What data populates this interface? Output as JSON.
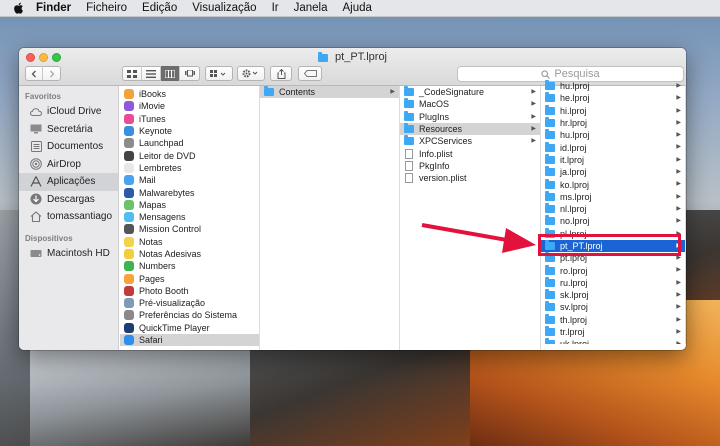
{
  "menubar": {
    "items": [
      "Finder",
      "Ficheiro",
      "Edição",
      "Visualização",
      "Ir",
      "Janela",
      "Ajuda"
    ]
  },
  "window": {
    "title": "pt_PT.lproj",
    "search_placeholder": "Pesquisa"
  },
  "sidebar": {
    "favorites_heading": "Favoritos",
    "favorites": [
      {
        "label": "iCloud Drive",
        "icon": "cloud-icon"
      },
      {
        "label": "Secretária",
        "icon": "desktop-icon"
      },
      {
        "label": "Documentos",
        "icon": "documents-icon"
      },
      {
        "label": "AirDrop",
        "icon": "airdrop-icon"
      },
      {
        "label": "Aplicações",
        "icon": "applications-icon",
        "selected": true
      },
      {
        "label": "Descargas",
        "icon": "downloads-icon"
      },
      {
        "label": "tomassantiago",
        "icon": "home-icon"
      }
    ],
    "devices_heading": "Dispositivos",
    "devices": [
      {
        "label": "Macintosh HD",
        "icon": "disk-icon"
      }
    ]
  },
  "column_apps": [
    {
      "label": "iBooks",
      "color": "#f2a23b"
    },
    {
      "label": "iMovie",
      "color": "#8e5bd8"
    },
    {
      "label": "iTunes",
      "color": "#e94d9a"
    },
    {
      "label": "Keynote",
      "color": "#3a8fe0"
    },
    {
      "label": "Launchpad",
      "color": "#8c8c8c"
    },
    {
      "label": "Leitor de DVD",
      "color": "#444444"
    },
    {
      "label": "Lembretes",
      "color": "#e8e8e8"
    },
    {
      "label": "Mail",
      "color": "#4aa3f0"
    },
    {
      "label": "Malwarebytes",
      "color": "#2b5aa8"
    },
    {
      "label": "Mapas",
      "color": "#6cc36b"
    },
    {
      "label": "Mensagens",
      "color": "#4fbdf0"
    },
    {
      "label": "Mission Control",
      "color": "#555555"
    },
    {
      "label": "Notas",
      "color": "#f5d24a"
    },
    {
      "label": "Notas Adesivas",
      "color": "#f1d03b"
    },
    {
      "label": "Numbers",
      "color": "#3fb34f"
    },
    {
      "label": "Pages",
      "color": "#f5a33a"
    },
    {
      "label": "Photo Booth",
      "color": "#c23a3a"
    },
    {
      "label": "Pré-visualização",
      "color": "#7f9bb5"
    },
    {
      "label": "Preferências do Sistema",
      "color": "#8a8a8a"
    },
    {
      "label": "QuickTime Player",
      "color": "#1d3d73"
    },
    {
      "label": "Safari",
      "color": "#2f8ee8",
      "selected": true
    }
  ],
  "column_safari": [
    {
      "label": "Contents",
      "type": "folder",
      "arrow": true,
      "selected": true
    }
  ],
  "column_contents": [
    {
      "label": "_CodeSignature",
      "type": "folder",
      "arrow": true
    },
    {
      "label": "MacOS",
      "type": "folder",
      "arrow": true
    },
    {
      "label": "PlugIns",
      "type": "folder",
      "arrow": true
    },
    {
      "label": "Resources",
      "type": "folder",
      "arrow": true,
      "selected": true
    },
    {
      "label": "XPCServices",
      "type": "folder",
      "arrow": true
    },
    {
      "label": "Info.plist",
      "type": "file"
    },
    {
      "label": "PkgInfo",
      "type": "file"
    },
    {
      "label": "version.plist",
      "type": "file"
    }
  ],
  "column_resources": [
    {
      "label": "hu.lproj"
    },
    {
      "label": "he.lproj"
    },
    {
      "label": "hi.lproj"
    },
    {
      "label": "hr.lproj"
    },
    {
      "label": "hu.lproj"
    },
    {
      "label": "id.lproj"
    },
    {
      "label": "it.lproj"
    },
    {
      "label": "ja.lproj"
    },
    {
      "label": "ko.lproj"
    },
    {
      "label": "ms.lproj"
    },
    {
      "label": "nl.lproj"
    },
    {
      "label": "no.lproj"
    },
    {
      "label": "pl.lproj"
    },
    {
      "label": "pt_PT.lproj",
      "selected": true
    },
    {
      "label": "pt.lproj"
    },
    {
      "label": "ro.lproj"
    },
    {
      "label": "ru.lproj"
    },
    {
      "label": "sk.lproj"
    },
    {
      "label": "sv.lproj"
    },
    {
      "label": "th.lproj"
    },
    {
      "label": "tr.lproj"
    },
    {
      "label": "uk.lproj"
    }
  ],
  "colors": {
    "selection_blue": "#1a64d6",
    "annotation_red": "#e3123c",
    "folder_blue": "#3fa8f4"
  }
}
